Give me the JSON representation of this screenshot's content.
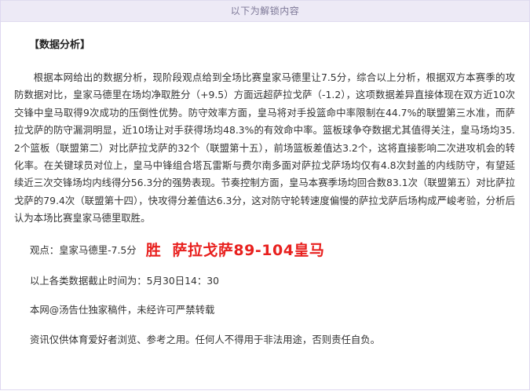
{
  "unlock_bar": {
    "text": "以下为解锁内容"
  },
  "article": {
    "section_title": "【数据分析】",
    "paragraph": "根据本网给出的数据分析，现阶段观点给到全场比赛皇家马德里让7.5分，综合以上分析，根据双方本赛季的攻防数据对比，皇家马德里在场均净取胜分（+9.5）方面远超萨拉戈萨（-1.2），这项数据差异直接体现在双方近10次交锋中皇马取得9次成功的压倒性优势。防守效率方面，皇马将对手投篮命中率限制在44.7%的联盟第三水准，而萨拉戈萨的防守漏洞明显，近10场让对手获得场均48.3%的有效命中率。篮板球争夺数据尤其值得关注，皇马场均35.2个篮板（联盟第二）对比萨拉戈萨的32个（联盟第十五），前场篮板差值达3.2个，这将直接影响二次进攻机会的转化率。在关键球员对位上，皇马中锋组合塔瓦雷斯与费尔南多面对萨拉戈萨场均仅有4.8次封盖的内线防守，有望延续近三次交锋场均内线得分56.3分的强势表现。节奏控制方面，皇马本赛季场均回合数83.1次（联盟第五）对比萨拉戈萨的79.4次（联盟第十四），快攻得分差值达6.3分，这对防守轮转速度偏慢的萨拉戈萨后场构成严峻考验，分析后认为本场比赛皇家马德里取胜。",
    "opinion_label": "观点：",
    "opinion_pick": "皇家马德里-7.5分",
    "opinion_result": "胜  萨拉戈萨89-104皇马",
    "deadline": "以上各类数据截止时间为：5月30日14：30",
    "copyright": "本网@汤告仕独家稿件，未经许可严禁转载",
    "disclaimer": "资讯仅供体育爱好者浏览、参考之用。任何人不得用于非法用途，否则责任自负。"
  },
  "colors": {
    "unlock_bar_bg": "#edeaf6",
    "unlock_bar_text": "#7d7897",
    "result_red": "#e8201e"
  }
}
